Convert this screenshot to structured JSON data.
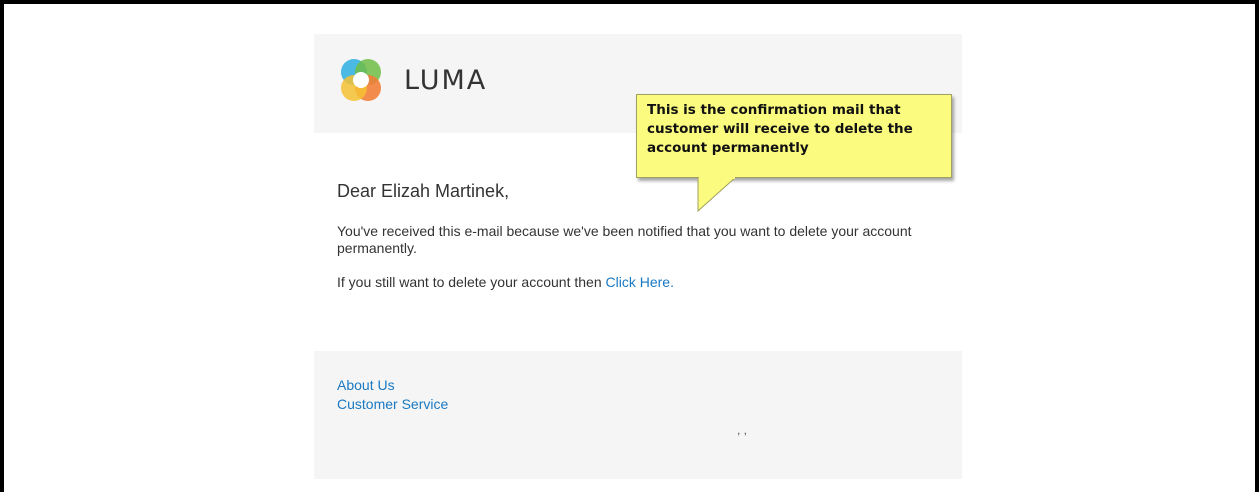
{
  "brand": {
    "logo_text": "LUMA"
  },
  "email": {
    "greeting": "Dear Elizah Martinek,",
    "paragraph1": "You've received this e-mail because we've been notified that you want to delete your account permanently.",
    "paragraph2_prefix": "If you still want to delete your account then ",
    "paragraph2_link": "Click Here."
  },
  "footer": {
    "links": [
      "About Us",
      "Customer Service"
    ],
    "address": ", ,"
  },
  "callout": {
    "text": "This is the confirmation mail that customer will receive to delete the account permanently"
  },
  "colors": {
    "link": "#1979c3",
    "callout_bg": "#fbfb80",
    "panel_bg": "#f5f5f5"
  }
}
